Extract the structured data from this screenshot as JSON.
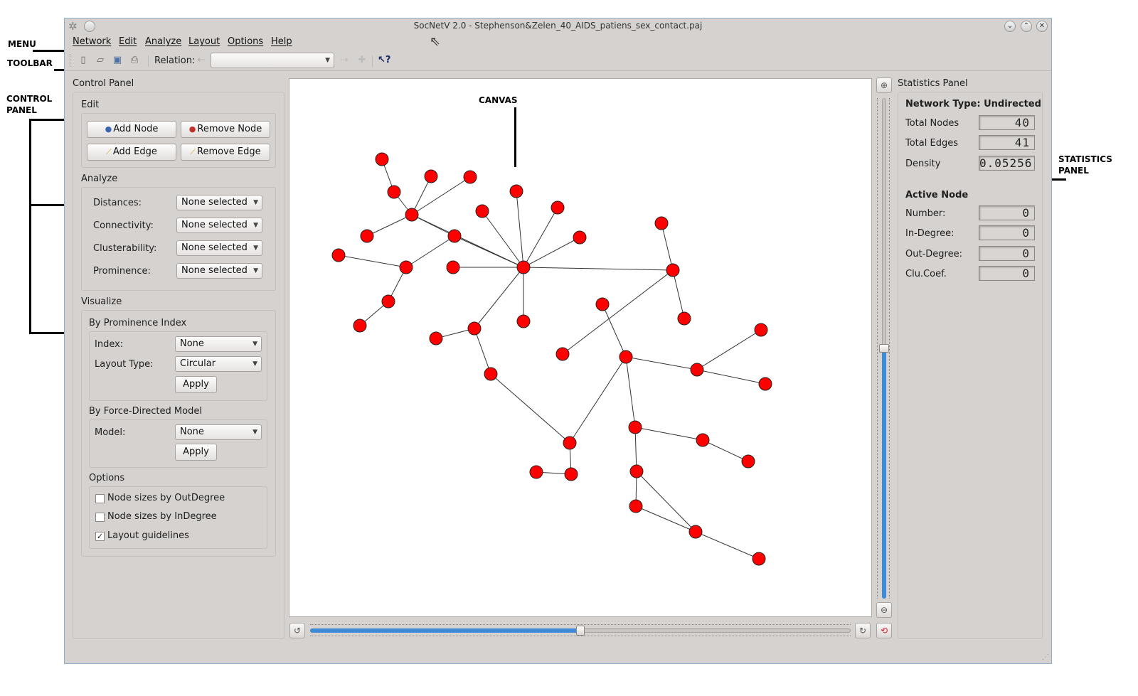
{
  "annotations": {
    "menu": "MENU",
    "toolbar": "TOOLBAR",
    "control_panel": "CONTROL\nPANEL",
    "canvas": "CANVAS",
    "statistics_panel": "STATISTICS\nPANEL"
  },
  "window": {
    "title": "SocNetV 2.0 - Stephenson&Zelen_40_AIDS_patiens_sex_contact.paj",
    "icon": "gear-icon"
  },
  "menu": [
    "Network",
    "Edit",
    "Analyze",
    "Layout",
    "Options",
    "Help"
  ],
  "toolbar": {
    "icons": [
      "new-file-icon",
      "open-file-icon",
      "save-icon",
      "print-icon"
    ],
    "relation_label": "Relation:",
    "relation_value": "",
    "help_icon": "whats-this-icon"
  },
  "control_panel": {
    "title": "Control Panel",
    "edit": {
      "title": "Edit",
      "add_node": "Add Node",
      "remove_node": "Remove Node",
      "add_edge": "Add Edge",
      "remove_edge": "Remove Edge"
    },
    "analyze": {
      "title": "Analyze",
      "rows": [
        {
          "label": "Distances:",
          "value": "None selected"
        },
        {
          "label": "Connectivity:",
          "value": "None selected"
        },
        {
          "label": "Clusterability:",
          "value": "None selected"
        },
        {
          "label": "Prominence:",
          "value": "None selected"
        }
      ]
    },
    "visualize": {
      "title": "Visualize",
      "prominence": {
        "title": "By Prominence Index",
        "index_label": "Index:",
        "index_value": "None",
        "layout_label": "Layout Type:",
        "layout_value": "Circular",
        "apply": "Apply"
      },
      "force": {
        "title": "By Force-Directed Model",
        "model_label": "Model:",
        "model_value": "None",
        "apply": "Apply"
      },
      "options": {
        "title": "Options",
        "items": [
          {
            "label": "Node sizes by OutDegree",
            "checked": false
          },
          {
            "label": "Node sizes by InDegree",
            "checked": false
          },
          {
            "label": "Layout guidelines",
            "checked": true
          }
        ]
      }
    }
  },
  "canvas": {
    "node_color": "#ff0000",
    "edge_color": "#333333"
  },
  "statistics_panel": {
    "title": "Statistics Panel",
    "network_type": "Network Type: Undirected",
    "total_nodes_label": "Total Nodes",
    "total_nodes": "40",
    "total_edges_label": "Total Edges",
    "total_edges": "41",
    "density_label": "Density",
    "density": "0.05256",
    "active_node_title": "Active Node",
    "active_rows": [
      {
        "label": "Number:",
        "value": "0"
      },
      {
        "label": "In-Degree:",
        "value": "0"
      },
      {
        "label": "Out-Degree:",
        "value": "0"
      },
      {
        "label": "Clu.Coef.",
        "value": "0"
      }
    ]
  },
  "zoom": {
    "level": 0.5
  },
  "rotate": {
    "level": 0.5
  }
}
